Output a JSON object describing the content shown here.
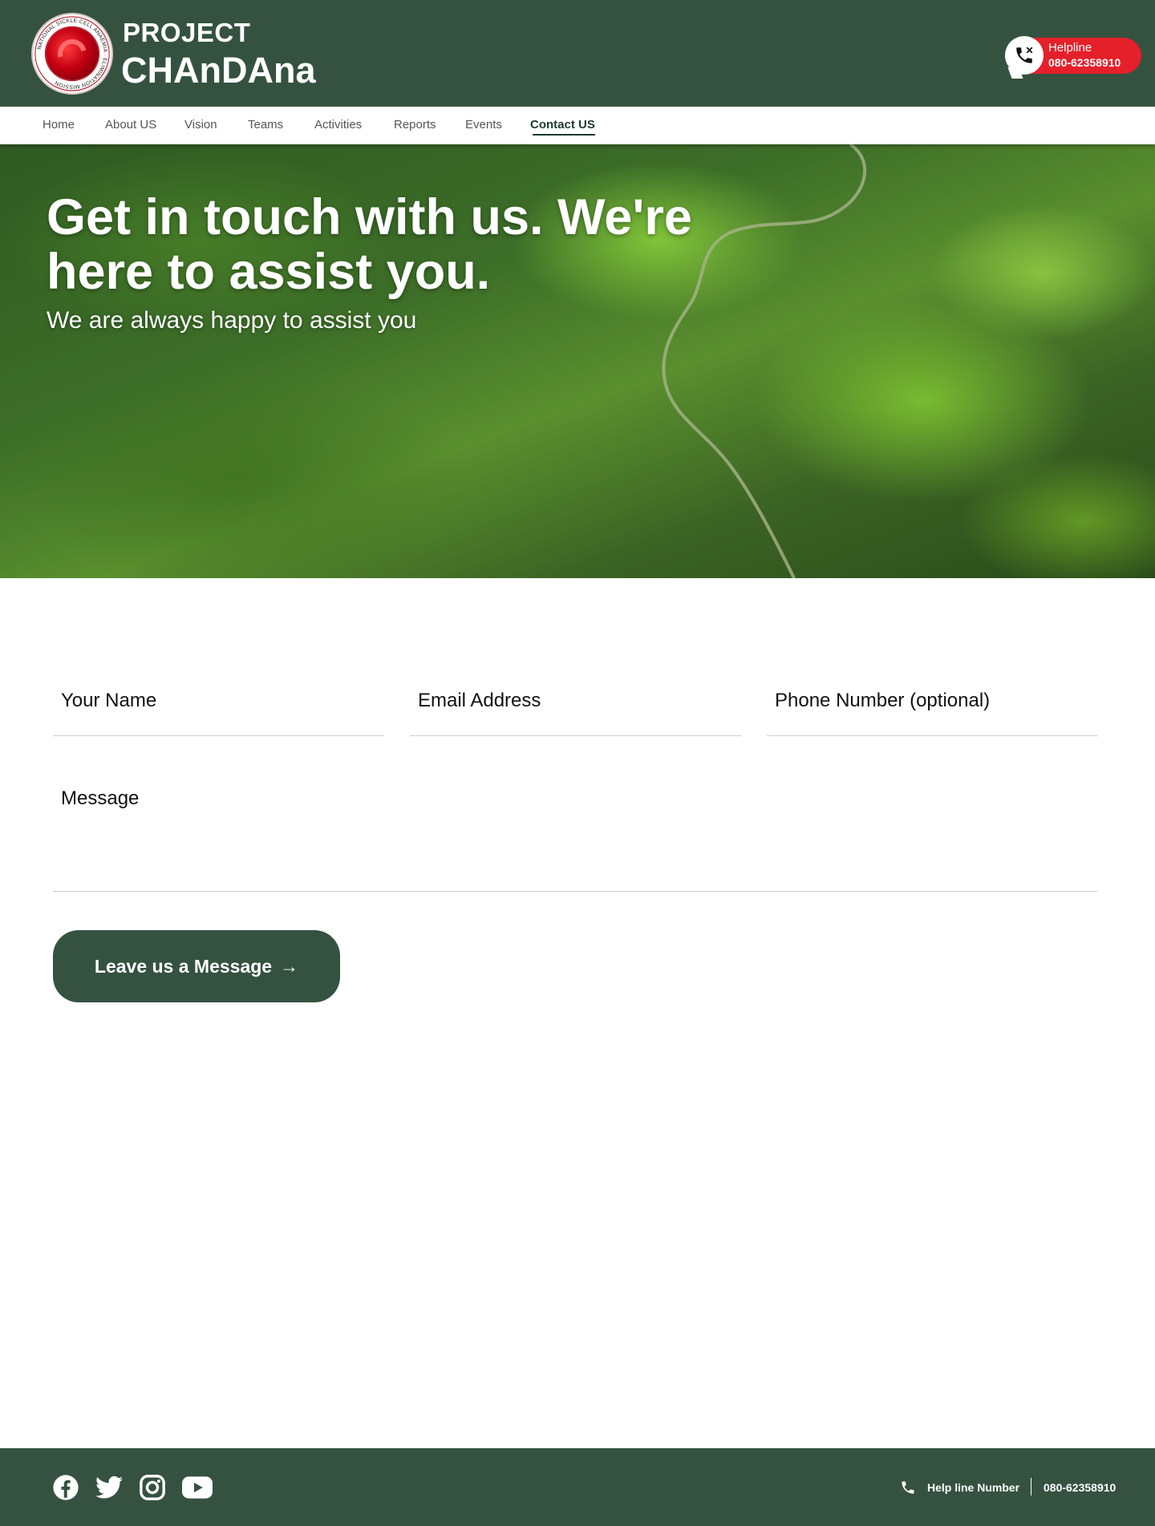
{
  "brand": {
    "logo_ring_text": "NATIONAL SICKLE CELL ANAEMIA · ELIMINATION MISSION",
    "line1": "PROJECT",
    "line2": "CHAnDAna"
  },
  "helpline": {
    "label": "Helpline",
    "number": "080-62358910"
  },
  "nav": {
    "items": [
      {
        "label": "Home"
      },
      {
        "label": "About US"
      },
      {
        "label": "Vision"
      },
      {
        "label": "Teams"
      },
      {
        "label": "Activities"
      },
      {
        "label": "Reports"
      },
      {
        "label": "Events"
      },
      {
        "label": "Contact US"
      }
    ],
    "active": "Contact US"
  },
  "hero": {
    "title": "Get in touch with us. We're here to assist you.",
    "subtitle": "We are always happy to assist you"
  },
  "form": {
    "name_placeholder": "Your Name",
    "email_placeholder": "Email Address",
    "phone_placeholder": "Phone Number (optional)",
    "message_placeholder": "Message",
    "submit_label": "Leave us a Message",
    "submit_arrow": "→"
  },
  "footer": {
    "social": [
      "facebook-icon",
      "twitter-icon",
      "instagram-icon",
      "youtube-icon"
    ],
    "help_label": "Help line Number",
    "help_number": "080-62358910"
  },
  "colors": {
    "primary": "#355241",
    "helpline_red": "#e5202a",
    "white": "#ffffff"
  }
}
